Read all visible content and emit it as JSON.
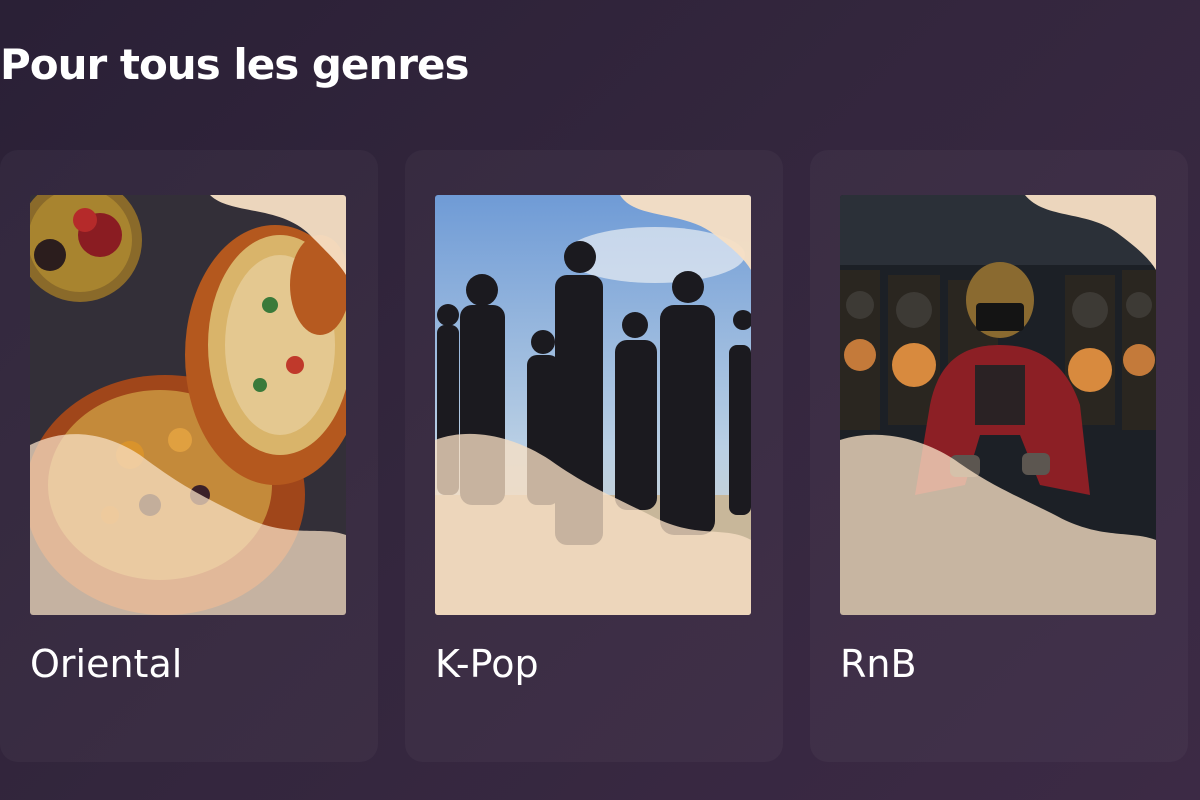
{
  "section": {
    "title": "Pour tous les genres"
  },
  "cards": [
    {
      "label": "Oriental",
      "image_icon": "tagine-photo"
    },
    {
      "label": "K-Pop",
      "image_icon": "kpop-group-photo"
    },
    {
      "label": "RnB",
      "image_icon": "speaker-wall-photo"
    }
  ],
  "colors": {
    "background": "#2f2439",
    "wave_overlay": "#f7dfc4",
    "text": "#ffffff"
  }
}
